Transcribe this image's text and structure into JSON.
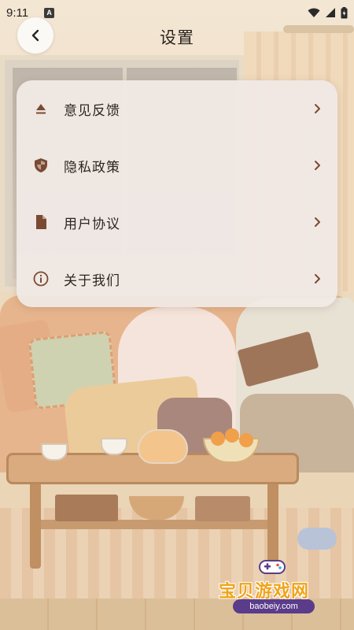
{
  "status_bar": {
    "time": "9:11",
    "notification_icon": "A"
  },
  "header": {
    "title": "设置",
    "back_icon": "chevron-left-icon"
  },
  "settings": {
    "items": [
      {
        "label": "意见反馈",
        "icon": "eject-icon"
      },
      {
        "label": "隐私政策",
        "icon": "shield-icon"
      },
      {
        "label": "用户协议",
        "icon": "document-icon"
      },
      {
        "label": "关于我们",
        "icon": "info-icon"
      }
    ]
  },
  "watermark": {
    "title": "宝贝游戏网",
    "url": "baobeiy.com"
  },
  "colors": {
    "icon_brown": "#7a4a33",
    "card_bg": "#f0e9e5",
    "watermark_orange": "#f0a41a"
  }
}
